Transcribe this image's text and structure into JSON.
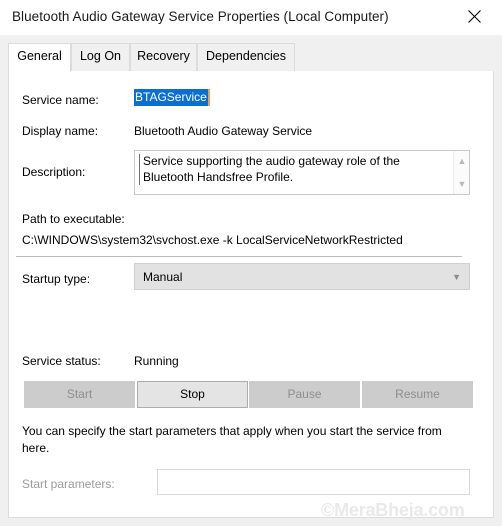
{
  "window": {
    "title": "Bluetooth Audio Gateway Service Properties (Local Computer)",
    "close_icon": "close-icon"
  },
  "tabs": [
    {
      "label": "General",
      "active": true
    },
    {
      "label": "Log On",
      "active": false
    },
    {
      "label": "Recovery",
      "active": false
    },
    {
      "label": "Dependencies",
      "active": false
    }
  ],
  "general": {
    "service_name_label": "Service name:",
    "service_name_value": "BTAGService",
    "display_name_label": "Display name:",
    "display_name_value": "Bluetooth Audio Gateway Service",
    "description_label": "Description:",
    "description_value": "Service supporting the audio gateway role of the Bluetooth Handsfree Profile.",
    "scroll_up_icon": "chevron-up-icon",
    "scroll_down_icon": "chevron-down-icon",
    "path_label": "Path to executable:",
    "path_value": "C:\\WINDOWS\\system32\\svchost.exe -k LocalServiceNetworkRestricted",
    "startup_type_label": "Startup type:",
    "startup_type_value": "Manual",
    "startup_chevron_icon": "chevron-down-icon",
    "status_label": "Service status:",
    "status_value": "Running",
    "buttons": [
      {
        "label": "Start",
        "enabled": false
      },
      {
        "label": "Stop",
        "enabled": true
      },
      {
        "label": "Pause",
        "enabled": false
      },
      {
        "label": "Resume",
        "enabled": false
      }
    ],
    "help_text": "You can specify the start parameters that apply when you start the service from here.",
    "start_parameters_label": "Start parameters:",
    "start_parameters_value": ""
  },
  "watermark": "©MeraBheja.com",
  "colors": {
    "selection_blue": "#0a6fd0",
    "caret_orange": "#e8a05a",
    "panel_background": "#ffffff",
    "window_background": "#f0f0f0",
    "disabled_button": "#cccccc",
    "enabled_button": "#e4e4e4"
  }
}
